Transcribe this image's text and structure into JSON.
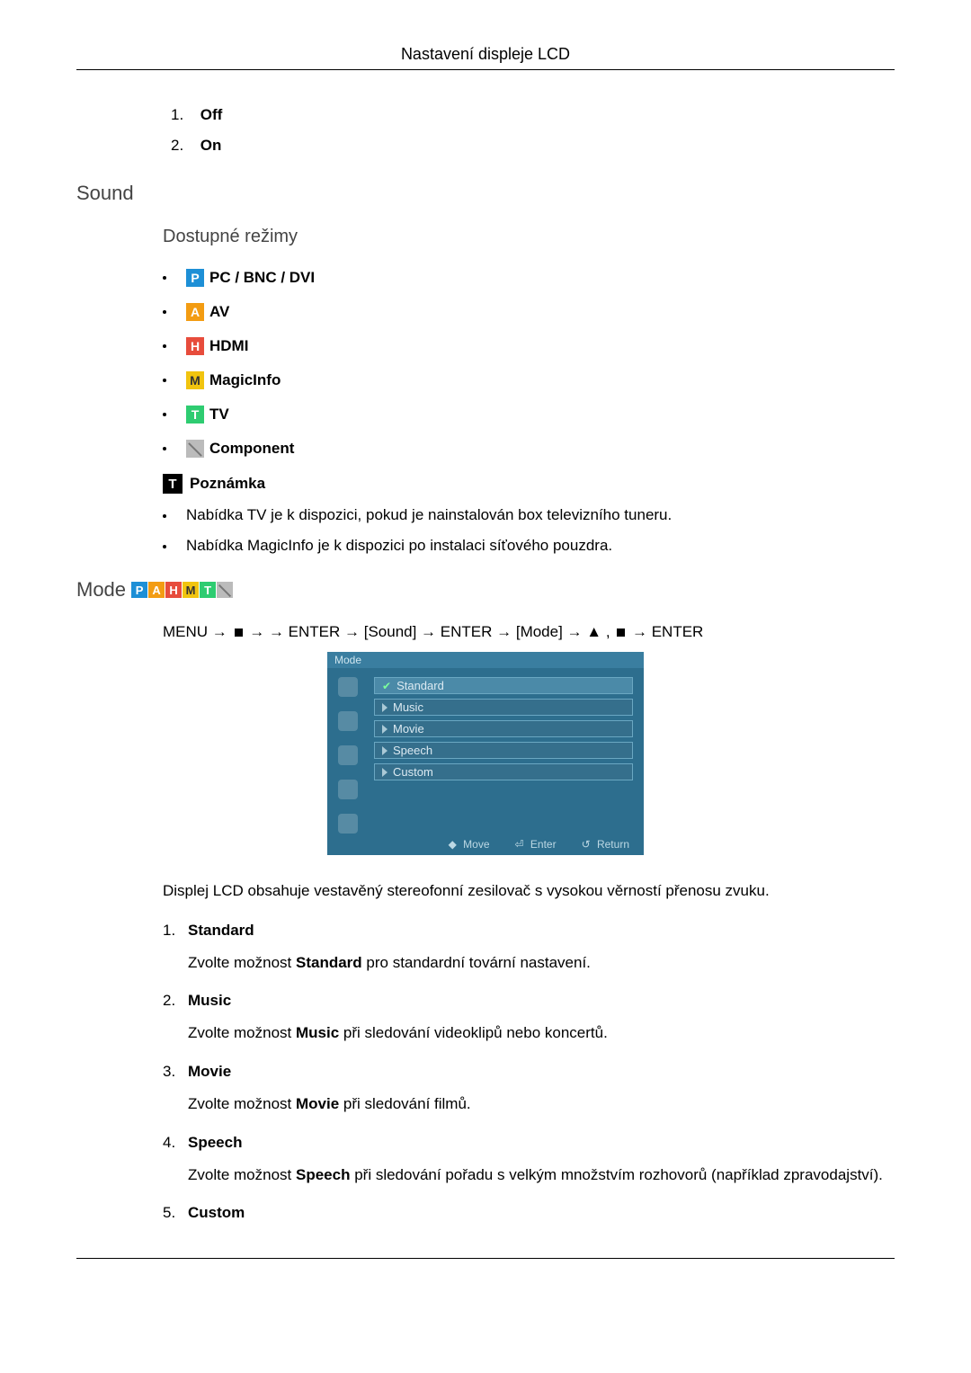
{
  "header": {
    "title": "Nastavení displeje LCD"
  },
  "offon_list": [
    {
      "num": "1.",
      "label": "Off"
    },
    {
      "num": "2.",
      "label": "On"
    }
  ],
  "sound_heading": "Sound",
  "available_modes_heading": "Dostupné režimy",
  "modes": [
    {
      "letter": "P",
      "cls": "icon-p",
      "label": "PC / BNC / DVI"
    },
    {
      "letter": "A",
      "cls": "icon-a",
      "label": "AV"
    },
    {
      "letter": "H",
      "cls": "icon-h",
      "label": "HDMI"
    },
    {
      "letter": "M",
      "cls": "icon-m",
      "label": "MagicInfo"
    },
    {
      "letter": "T",
      "cls": "icon-t",
      "label": "TV"
    },
    {
      "letter": "",
      "cls": "icon-c",
      "label": "Component"
    }
  ],
  "note_label": "Poznámka",
  "notes": [
    "Nabídka TV je k dispozici, pokud je nainstalován box televizního tuneru.",
    "Nabídka MagicInfo je k dispozici po instalaci síťového pouzdra."
  ],
  "mode_heading": "Mode",
  "breadcrumb_parts": {
    "a": "MENU → ",
    "b": " →   → ENTER → [Sound] → ENTER → [Mode] → ",
    "c": " , ",
    "d": " → ENTER"
  },
  "osd": {
    "title": "Mode",
    "items": [
      "Standard",
      "Music",
      "Movie",
      "Speech",
      "Custom"
    ],
    "footer": {
      "move": "Move",
      "enter": "Enter",
      "ret": "Return"
    }
  },
  "desc": "Displej LCD obsahuje vestavěný stereofonní zesilovač s vysokou věrností přenosu zvuku.",
  "mode_list": [
    {
      "num": "1.",
      "name": "Standard",
      "body_a": "Zvolte možnost ",
      "body_b": " pro standardní tovární nastavení."
    },
    {
      "num": "2.",
      "name": "Music",
      "body_a": "Zvolte možnost ",
      "body_b": " při sledování videoklipů nebo koncertů."
    },
    {
      "num": "3.",
      "name": "Movie",
      "body_a": "Zvolte možnost ",
      "body_b": " při sledování filmů."
    },
    {
      "num": "4.",
      "name": "Speech",
      "body_a": "Zvolte možnost ",
      "body_b": " při sledování pořadu s velkým množstvím rozhovorů (například zpravodajství)."
    },
    {
      "num": "5.",
      "name": "Custom",
      "body_a": "",
      "body_b": ""
    }
  ]
}
